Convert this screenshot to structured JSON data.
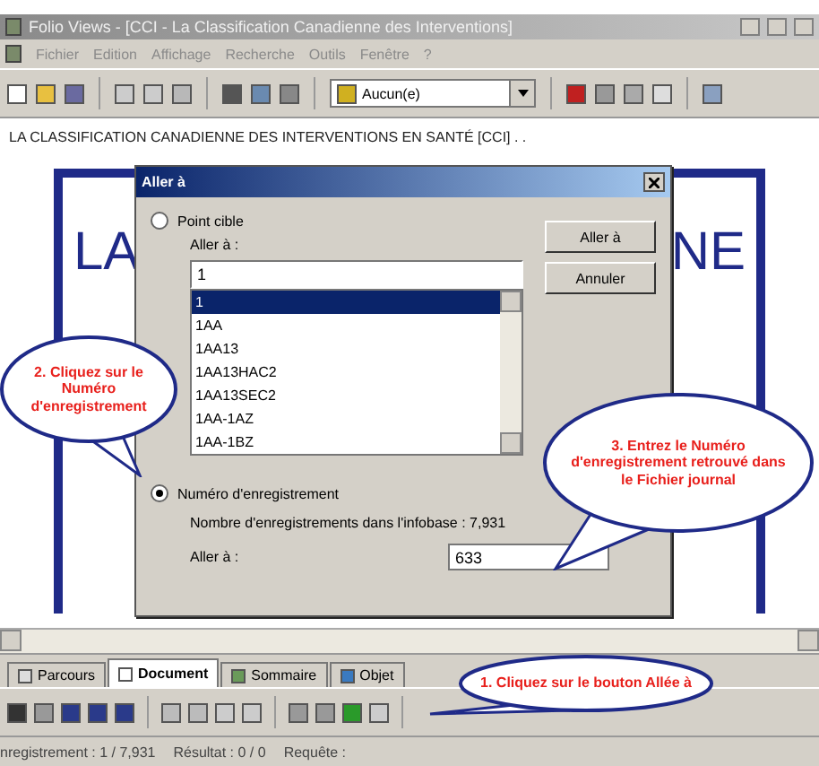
{
  "window": {
    "title": "Folio Views - [CCI - La Classification Canadienne des Interventions]"
  },
  "menu": [
    "Fichier",
    "Edition",
    "Affichage",
    "Recherche",
    "Outils",
    "Fenêtre",
    "?"
  ],
  "toolbar": {
    "dropdown": "Aucun(e)"
  },
  "document": {
    "header": "LA CLASSIFICATION CANADIENNE DES INTERVENTIONS EN SANTÉ [CCI] . .",
    "left_text": "LA",
    "right_text": "NE"
  },
  "dialog": {
    "title": "Aller à",
    "options": [
      {
        "label": "Point cible",
        "selected": false
      },
      {
        "label": "Numéro d'enregistrement",
        "selected": true
      }
    ],
    "target_label": "Aller à :",
    "target_value": "1",
    "list": [
      {
        "label": "1",
        "selected": true
      },
      {
        "label": "1AA",
        "selected": false
      },
      {
        "label": "1AA13",
        "selected": false
      },
      {
        "label": "1AA13HAC2",
        "selected": false
      },
      {
        "label": "1AA13SEC2",
        "selected": false
      },
      {
        "label": "1AA-1AZ",
        "selected": false
      },
      {
        "label": "1AA-1BZ",
        "selected": false
      }
    ],
    "record_count": "Nombre d'enregistrements dans l'infobase : 7,931",
    "record_label": "Aller à :",
    "record_value": "633",
    "buttons": [
      "Aller à",
      "Annuler"
    ]
  },
  "tabs": [
    {
      "label": "Parcours",
      "selected": false
    },
    {
      "label": "Document",
      "selected": true
    },
    {
      "label": "Sommaire",
      "selected": false
    },
    {
      "label": "Objet",
      "selected": false
    }
  ],
  "status_bar": [
    "nregistrement : 1 / 7,931",
    "Résultat : 0 / 0",
    "Requête :"
  ],
  "callouts": [
    {
      "text": "2. Cliquez sur le Numéro d'enregistrement"
    },
    {
      "text": "3. Entrez le Numéro d'enregistrement retrouvé dans le Fichier journal"
    },
    {
      "text": "1. Cliquez sur le bouton Allée à"
    }
  ]
}
